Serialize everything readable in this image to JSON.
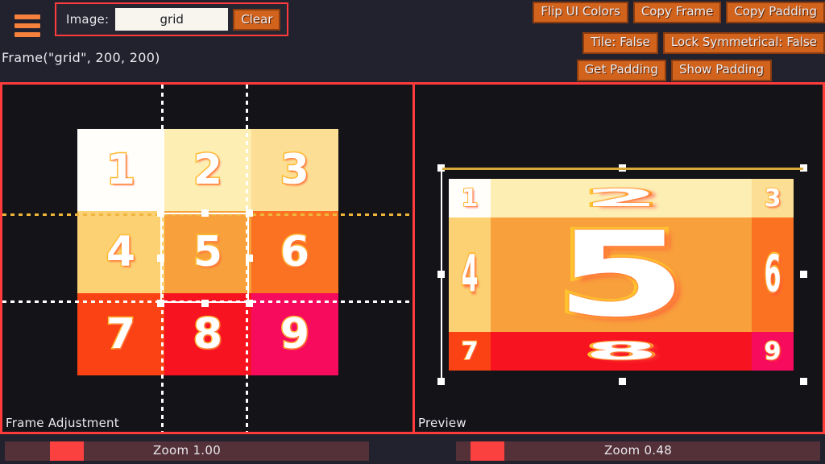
{
  "window": {
    "background": "#22222e",
    "panel_bg": "#131318",
    "accent_red": "#ff3b3b",
    "accent_orange": "#d2631d"
  },
  "toolbar": {
    "menu_icon": "hamburger-icon",
    "image_label": "Image:",
    "image_value": "grid",
    "image_placeholder": "grid",
    "clear_label": "Clear"
  },
  "frame_info": {
    "text": "Frame(\"grid\", 200, 200)"
  },
  "buttons": {
    "row1": [
      {
        "label": "Flip UI Colors",
        "name": "flip-ui-colors-button"
      },
      {
        "label": "Copy Frame",
        "name": "copy-frame-button"
      },
      {
        "label": "Copy Padding",
        "name": "copy-padding-button"
      }
    ],
    "row2": [
      {
        "label": "Tile: False",
        "name": "tile-toggle-button"
      },
      {
        "label": "Lock Symmetrical: False",
        "name": "lock-symmetrical-toggle-button"
      }
    ],
    "row3": [
      {
        "label": "Get Padding",
        "name": "get-padding-button"
      },
      {
        "label": "Show Padding",
        "name": "show-padding-button"
      }
    ]
  },
  "panels": {
    "frame": {
      "caption": "Frame Adjustment"
    },
    "preview": {
      "caption": "Preview"
    }
  },
  "artwork": {
    "name": "grid",
    "size": [
      200,
      200
    ],
    "cells": [
      {
        "n": "1",
        "color": "#fffefb"
      },
      {
        "n": "2",
        "color": "#fdeeb4"
      },
      {
        "n": "3",
        "color": "#fcdf94"
      },
      {
        "n": "4",
        "color": "#fbd173"
      },
      {
        "n": "5",
        "color": "#f8a03c"
      },
      {
        "n": "6",
        "color": "#fb7222"
      },
      {
        "n": "7",
        "color": "#fa4215"
      },
      {
        "n": "8",
        "color": "#f71320"
      },
      {
        "n": "9",
        "color": "#f70b5c"
      }
    ],
    "digit_fill": "#ffffff",
    "digit_outline": "#ffc42e"
  },
  "guides": {
    "vertical_color": "#ffffff",
    "horizontal_top_color": "#f0b63c",
    "horizontal_bottom_color": "#ffffff",
    "selection_color": "#ffffff"
  },
  "zoom_left": {
    "label": "Zoom 1.00",
    "value": 1.0
  },
  "zoom_right": {
    "label": "Zoom 0.48",
    "value": 0.48
  }
}
